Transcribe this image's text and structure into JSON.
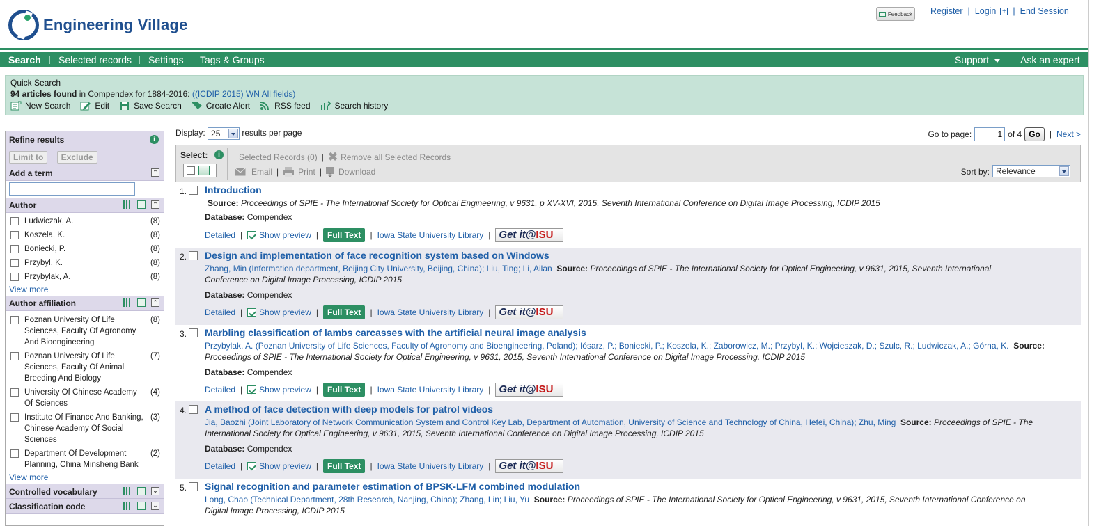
{
  "brand": {
    "name": "Engineering Village",
    "accent": "#2d8f63",
    "logo_color": "#1f4f8f"
  },
  "header": {
    "feedback_label": "Feedback",
    "links": [
      "Register",
      "Login",
      "End Session"
    ]
  },
  "nav": {
    "items": [
      "Search",
      "Selected records",
      "Settings",
      "Tags & Groups"
    ],
    "right": [
      "Support",
      "Ask an expert"
    ]
  },
  "summary": {
    "heading": "Quick Search",
    "count_text": "94 articles found",
    "scope_text": " in Compendex for 1884-2016: ",
    "query": "((ICDIP 2015) WN All fields)",
    "actions": [
      "New Search",
      "Edit",
      "Save Search",
      "Create Alert",
      "RSS feed",
      "Search history"
    ]
  },
  "sidebar": {
    "refine_title": "Refine results",
    "limit_label": "Limit to",
    "exclude_label": "Exclude",
    "add_term_label": "Add a term",
    "view_more": "View more",
    "author_title": "Author",
    "authors": [
      {
        "name": "Ludwiczak, A.",
        "count": "(8)"
      },
      {
        "name": "Koszela, K.",
        "count": "(8)"
      },
      {
        "name": "Boniecki, P.",
        "count": "(8)"
      },
      {
        "name": "Przybyl, K.",
        "count": "(8)"
      },
      {
        "name": "Przybylak, A.",
        "count": "(8)"
      }
    ],
    "affiliation_title": "Author affiliation",
    "affiliations": [
      {
        "name": "Poznan University Of Life Sciences, Faculty Of Agronomy And Bioengineering",
        "count": "(8)"
      },
      {
        "name": "Poznan University Of Life Sciences, Faculty Of Animal Breeding And Biology",
        "count": "(7)"
      },
      {
        "name": "University Of Chinese Academy Of Sciences",
        "count": "(4)"
      },
      {
        "name": "Institute Of Finance And Banking, Chinese Academy Of Social Sciences",
        "count": "(3)"
      },
      {
        "name": "Department Of Development Planning, China Minsheng Bank",
        "count": "(2)"
      }
    ],
    "controlled_title": "Controlled vocabulary",
    "classification_title": "Classification code"
  },
  "display": {
    "label": "Display:",
    "value": "25",
    "suffix": "results per page",
    "goto_label": "Go to page:",
    "page": "1",
    "of_text": "of 4",
    "go_label": "Go",
    "next_label": "Next >"
  },
  "toolbar": {
    "select_label": "Select:",
    "selected_records": "Selected Records (0)",
    "remove_all": "Remove all Selected Records",
    "email": "Email",
    "print": "Print",
    "download": "Download",
    "sort_label": "Sort by:",
    "sort_value": "Relevance"
  },
  "link_labels": {
    "detailed": "Detailed",
    "preview": "Show preview",
    "fulltext": "Full Text",
    "library": "Iowa State University Library",
    "getit": "Get it",
    "getit_brand": "ISU",
    "getit_at": "@",
    "source_label": "Source:",
    "database_label": "Database:"
  },
  "results": [
    {
      "num": "1.",
      "title": "Introduction",
      "authors_text": "",
      "source": "Proceedings of SPIE - The International Society for Optical Engineering, v 9631, p XV-XVI, 2015, Seventh International Conference on Digital Image Processing, ICDIP 2015",
      "database": "Compendex"
    },
    {
      "num": "2.",
      "title": "Design and implementation of face recognition system based on Windows",
      "authors_text": "Zhang, Min (Information department, Beijing City University, Beijing, China); Liu, Ting; Li, Ailan",
      "source": "Proceedings of SPIE - The International Society for Optical Engineering, v 9631, 2015, Seventh International Conference on Digital Image Processing, ICDIP 2015",
      "database": "Compendex"
    },
    {
      "num": "3.",
      "title": "Marbling classification of lambs carcasses with the artificial neural image analysis",
      "authors_text": "Przybylak, A. (Poznan University of Life Sciences, Faculty of Agronomy and Bioengineering, Poland); Iósarz, P.; Boniecki, P.; Koszela, K.; Zaborowicz, M.; Przybył, K.; Wojcieszak, D.; Szulc, R.; Ludwiczak, A.; Górna, K.",
      "source": "Proceedings of SPIE - The International Society for Optical Engineering, v 9631, 2015, Seventh International Conference on Digital Image Processing, ICDIP 2015",
      "database": "Compendex"
    },
    {
      "num": "4.",
      "title": "A method of face detection with deep models for patrol videos",
      "authors_text": "Jia, Baozhi (Joint Laboratory of Network Communication System and Control Key Lab, Department of Automation, University of Science and Technology of China, Hefei, China); Zhu, Ming",
      "source": "Proceedings of SPIE - The International Society for Optical Engineering, v 9631, 2015, Seventh International Conference on Digital Image Processing, ICDIP 2015",
      "database": "Compendex"
    },
    {
      "num": "5.",
      "title": "Signal recognition and parameter estimation of BPSK-LFM combined modulation",
      "authors_text": "Long, Chao (Technical Department, 28th Research, Nanjing, China); Zhang, Lin; Liu, Yu",
      "source": "Proceedings of SPIE - The International Society for Optical Engineering, v 9631, 2015, Seventh International Conference on Digital Image Processing, ICDIP 2015",
      "database": ""
    }
  ]
}
